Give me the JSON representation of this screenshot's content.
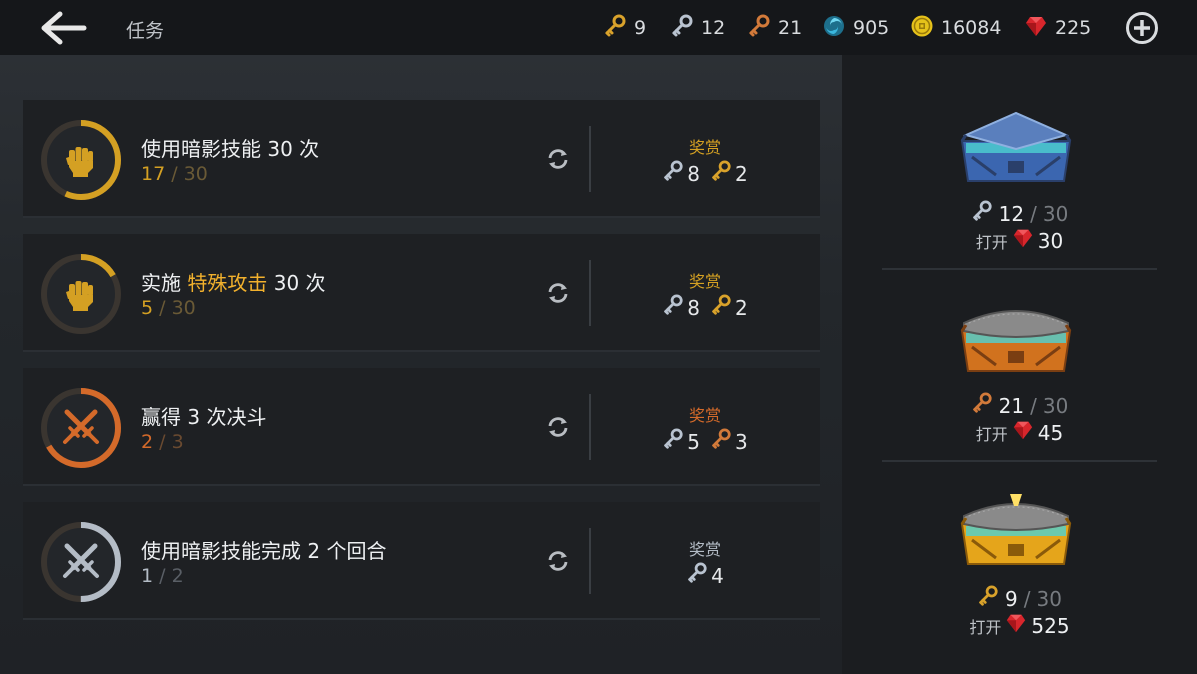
{
  "header": {
    "title": "任务",
    "currencies": [
      {
        "icon": "gold-key-icon",
        "value": "9",
        "color": "#d9a22b"
      },
      {
        "icon": "silver-key-icon",
        "value": "12",
        "color": "#b9c3d0"
      },
      {
        "icon": "bronze-key-icon",
        "value": "21",
        "color": "#d27a3a"
      },
      {
        "icon": "shadow-energy-icon",
        "value": "905",
        "color": "#35a6c9"
      },
      {
        "icon": "gold-coin-icon",
        "value": "16084",
        "color": "#e6c21a"
      },
      {
        "icon": "ruby-icon",
        "value": "225",
        "color": "#d8262c"
      }
    ]
  },
  "quests": [
    {
      "icon": "fist-icon",
      "ring_color": "#d4a023",
      "progress_color": "#d4a023",
      "text_before": "使用暗影技能 30 次",
      "text_highlight": "",
      "text_after": "",
      "current": "17",
      "sep": " / ",
      "total": "30",
      "completion": 0.567,
      "reward_label": "奖赏",
      "reward_label_color": "#d4a023",
      "rewards": [
        {
          "icon": "silver-key-icon",
          "count": "8"
        },
        {
          "icon": "gold-key-icon",
          "count": "2"
        }
      ]
    },
    {
      "icon": "fist-icon",
      "ring_color": "#d4a023",
      "progress_color": "#d4a023",
      "text_before": "实施 ",
      "text_highlight": "特殊攻击",
      "text_after": " 30 次",
      "current": "5",
      "sep": " / ",
      "total": "30",
      "completion": 0.167,
      "reward_label": "奖赏",
      "reward_label_color": "#d4a023",
      "rewards": [
        {
          "icon": "silver-key-icon",
          "count": "8"
        },
        {
          "icon": "gold-key-icon",
          "count": "2"
        }
      ]
    },
    {
      "icon": "crossed-swords-icon",
      "ring_color": "#d46a2a",
      "progress_color": "#d46a2a",
      "text_before": "赢得 3 次决斗",
      "text_highlight": "",
      "text_after": "",
      "current": "2",
      "sep": " / ",
      "total": "3",
      "completion": 0.667,
      "reward_label": "奖赏",
      "reward_label_color": "#d46a2a",
      "rewards": [
        {
          "icon": "silver-key-icon",
          "count": "5"
        },
        {
          "icon": "bronze-key-icon",
          "count": "3"
        }
      ]
    },
    {
      "icon": "crossed-swords-icon",
      "ring_color": "#b4bcc6",
      "progress_color": "#b4bcc6",
      "text_before": "使用暗影技能完成 2 个回合",
      "text_highlight": "",
      "text_after": "",
      "current": "1",
      "sep": " / ",
      "total": "2",
      "completion": 0.5,
      "reward_label": "奖赏",
      "reward_label_color": "#b4bcc6",
      "rewards": [
        {
          "icon": "silver-key-icon",
          "count": "4"
        }
      ]
    }
  ],
  "chests": [
    {
      "tier": "silver",
      "key_icon": "silver-key-icon",
      "keys_have": "12",
      "sep": "/",
      "keys_need": "30",
      "open_label": "打开",
      "gem_icon": "ruby-icon",
      "open_cost": "30",
      "colors": {
        "top": "#5a7fbd",
        "body": "#3b66b0",
        "trim": "#2a3f6a",
        "glow": "#4dd2d2"
      }
    },
    {
      "tier": "bronze",
      "key_icon": "bronze-key-icon",
      "keys_have": "21",
      "sep": "/",
      "keys_need": "30",
      "open_label": "打开",
      "gem_icon": "ruby-icon",
      "open_cost": "45",
      "colors": {
        "top": "#8a8a8a",
        "body": "#d1721e",
        "trim": "#7a3e12",
        "glow": "#4dd2d2"
      }
    },
    {
      "tier": "gold",
      "key_icon": "gold-key-icon",
      "keys_have": "9",
      "sep": "/",
      "keys_need": "30",
      "open_label": "打开",
      "gem_icon": "ruby-icon",
      "open_cost": "525",
      "colors": {
        "top": "#8a8a8a",
        "body": "#e5a51b",
        "trim": "#8a5a0a",
        "glow": "#4dd2d2"
      }
    }
  ]
}
